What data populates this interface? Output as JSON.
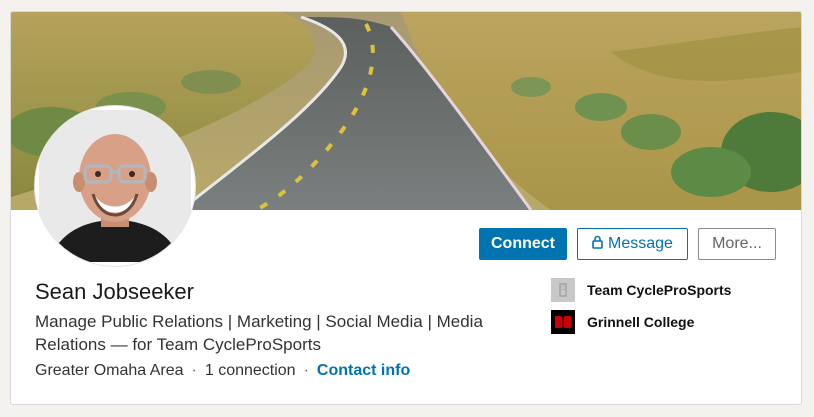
{
  "profile": {
    "name": "Sean Jobseeker",
    "headline": "Manage Public Relations | Marketing | Social Media | Media Relations — for Team CycleProSports",
    "location": "Greater Omaha Area",
    "connections": "1 connection",
    "contact_info": "Contact info",
    "separator": "·"
  },
  "actions": {
    "connect": "Connect",
    "message": "Message",
    "more": "More..."
  },
  "organizations": [
    {
      "name": "Team CycleProSports",
      "icon": "company-placeholder-icon"
    },
    {
      "name": "Grinnell College",
      "icon": "grinnell-college-logo"
    }
  ],
  "colors": {
    "accent": "#0073b1",
    "grinnell_red": "#cc0000"
  }
}
